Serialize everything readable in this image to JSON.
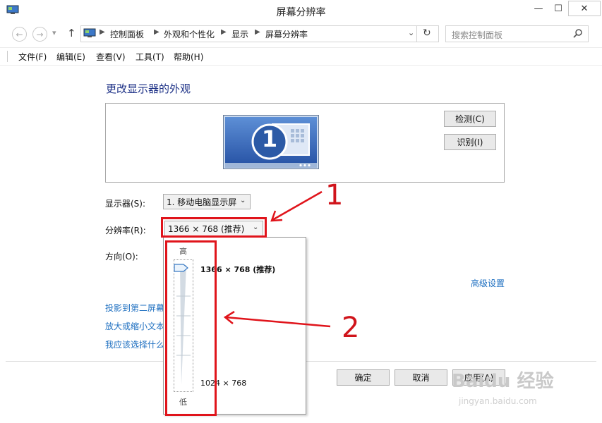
{
  "window": {
    "title": "屏幕分辨率"
  },
  "title_buttons": {
    "minimize": "—",
    "maximize": "☐",
    "close": "✕"
  },
  "nav": {
    "back": "←",
    "forward": "→",
    "dropdown": "▾",
    "up": "↑"
  },
  "breadcrumb": [
    "控制面板",
    "外观和个性化",
    "显示",
    "屏幕分辨率"
  ],
  "search": {
    "placeholder": "搜索控制面板"
  },
  "menu": [
    "文件(F)",
    "编辑(E)",
    "查看(V)",
    "工具(T)",
    "帮助(H)"
  ],
  "main": {
    "heading": "更改显示器的外观",
    "monitor_number": "1",
    "detect_button": "检测(C)",
    "identify_button": "识别(I)",
    "display_label": "显示器(S):",
    "display_value": "1. 移动电脑显示屏",
    "resolution_label": "分辨率(R):",
    "resolution_value": "1366 × 768 (推荐)",
    "orientation_label": "方向(O):",
    "advanced_link": "高级设置",
    "links": [
      "投影到第二屏幕",
      "放大或缩小文本",
      "我应该选择什么"
    ]
  },
  "dropdown": {
    "high_label": "高",
    "low_label": "低",
    "top_option": "1366 × 768 (推荐)",
    "bottom_option": "1024 × 768",
    "slider_level": 1.0
  },
  "footer": {
    "ok": "确定",
    "cancel": "取消",
    "apply": "应用(A)"
  },
  "annotations": {
    "one": "1",
    "two": "2"
  },
  "watermark": {
    "brand": "Baidu 经验",
    "url": "jingyan.baidu.com"
  },
  "colors": {
    "accent_red": "#e0141b",
    "link_blue": "#1e6fc0",
    "heading_blue": "#1e3287",
    "monitor_blue": "#2a5fb5"
  }
}
